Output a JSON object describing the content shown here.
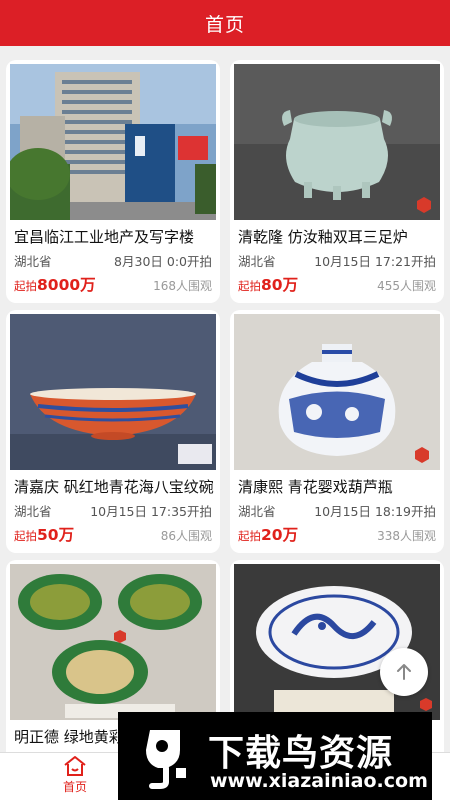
{
  "header": {
    "title": "首页"
  },
  "cards": [
    {
      "title": "宜昌临江工业地产及写字楼",
      "location": "湖北省",
      "time": "8月30日 0:0开拍",
      "price_label": "起拍",
      "price": "8000万",
      "views": "168人围观",
      "image": "building"
    },
    {
      "title": "清乾隆 仿汝釉双耳三足炉",
      "location": "湖北省",
      "time": "10月15日 17:21开拍",
      "price_label": "起拍",
      "price": "80万",
      "views": "455人围观",
      "image": "celadon-censer"
    },
    {
      "title": "清嘉庆 矾红地青花海八宝纹碗",
      "location": "湖北省",
      "time": "10月15日 17:35开拍",
      "price_label": "起拍",
      "price": "50万",
      "views": "86人围观",
      "image": "red-bowl"
    },
    {
      "title": "清康熙 青花婴戏葫芦瓶",
      "location": "湖北省",
      "time": "10月15日 18:19开拍",
      "price_label": "起拍",
      "price": "20万",
      "views": "338人围观",
      "image": "blue-white-vase"
    },
    {
      "title": "明正德 绿地黄彩龙纹罐",
      "location": "",
      "time": "",
      "price_label": "",
      "price": "",
      "views": "",
      "image": "green-jars"
    },
    {
      "title": "",
      "location": "",
      "time": "",
      "price_label": "",
      "price": "",
      "views": "",
      "image": "dragon-plate"
    }
  ],
  "fab": {
    "icon": "arrow-up-icon"
  },
  "tabbar": {
    "home_label": "首页",
    "home_icon": "home-icon"
  },
  "watermark": {
    "brand": "下载鸟资源",
    "url": "www.xiazainiao.com"
  },
  "colors": {
    "accent": "#dc1f26",
    "price": "#e0211b"
  }
}
